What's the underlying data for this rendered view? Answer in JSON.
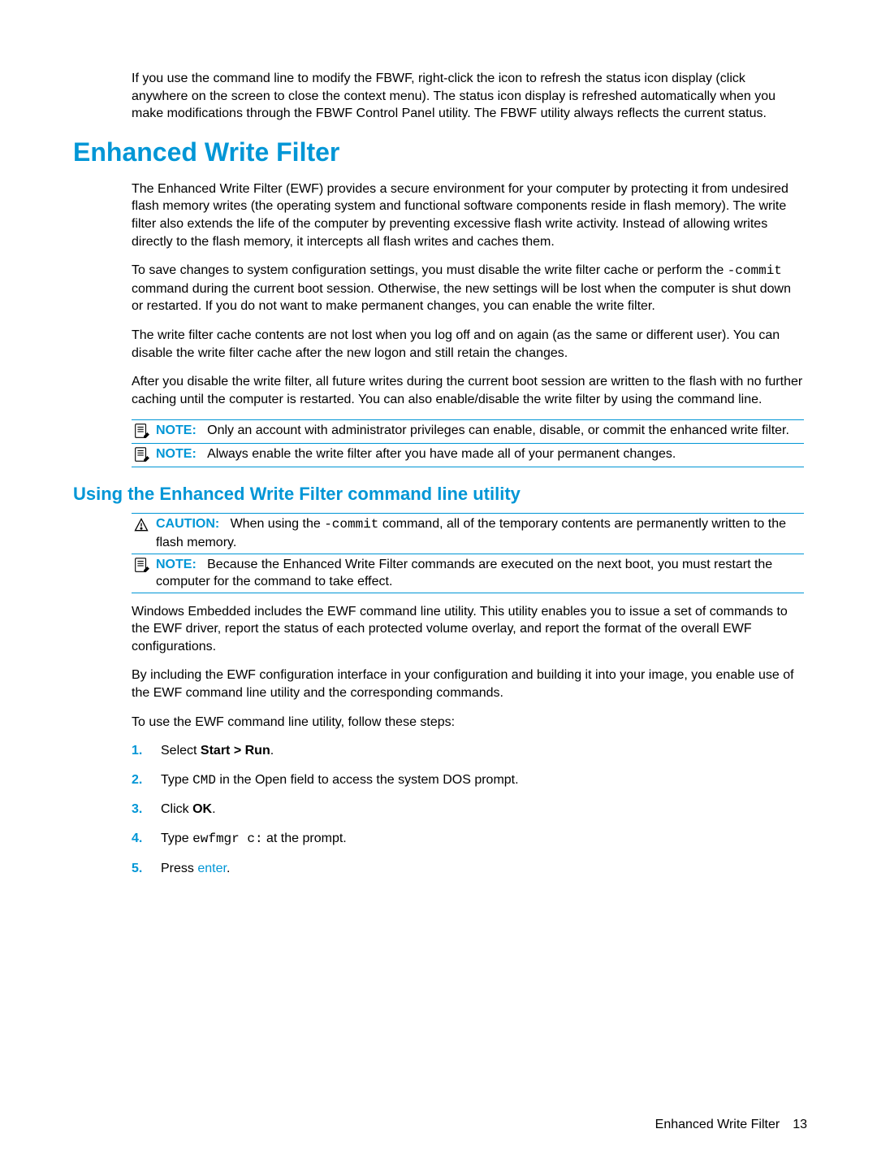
{
  "intro": "If you use the command line to modify the FBWF, right-click the icon to refresh the status icon display (click anywhere on the screen to close the context menu). The status icon display is refreshed automatically when you make modifications through the FBWF Control Panel utility. The FBWF utility always reflects the current status.",
  "h1": "Enhanced Write Filter",
  "p1": "The Enhanced Write Filter (EWF) provides a secure environment for your computer by protecting it from undesired flash memory writes (the operating system and functional software components reside in flash memory). The write filter also extends the life of the computer by preventing excessive flash write activity. Instead of allowing writes directly to the flash memory, it intercepts all flash writes and caches them.",
  "p2a": "To save changes to system configuration settings, you must disable the write filter cache or perform the ",
  "p2b": " command during the current boot session. Otherwise, the new settings will be lost when the computer is shut down or restarted. If you do not want to make permanent changes, you can enable the write filter.",
  "code_commit": "-commit",
  "p3": "The write filter cache contents are not lost when you log off and on again (as the same or different user). You can disable the write filter cache after the new logon and still retain the changes.",
  "p4": "After you disable the write filter, all future writes during the current boot session are written to the flash with no further caching until the computer is restarted. You can also enable/disable the write filter by using the command line.",
  "note_label": "NOTE:",
  "caution_label": "CAUTION:",
  "note1": "Only an account with administrator privileges can enable, disable, or commit the enhanced write filter.",
  "note2": "Always enable the write filter after you have made all of your permanent changes.",
  "h2": "Using the Enhanced Write Filter command line utility",
  "caution_a": "When using the ",
  "caution_b": " command, all of the temporary contents are permanently written to the flash memory.",
  "note3": "Because the Enhanced Write Filter commands are executed on the next boot, you must restart the computer for the command to take effect.",
  "p5": "Windows Embedded includes the EWF command line utility. This utility enables you to issue a set of commands to the EWF driver, report the status of each protected volume overlay, and report the format of the overall EWF configurations.",
  "p6": "By including the EWF configuration interface in your configuration and building it into your image, you enable use of the EWF command line utility and the corresponding commands.",
  "p7": "To use the EWF command line utility, follow these steps:",
  "steps": {
    "n1": "1.",
    "s1a": "Select ",
    "s1b": "Start > Run",
    "s1c": ".",
    "n2": "2.",
    "s2a": "Type ",
    "s2b": "CMD",
    "s2c": " in the Open field to access the system DOS prompt.",
    "n3": "3.",
    "s3a": "Click ",
    "s3b": "OK",
    "s3c": ".",
    "n4": "4.",
    "s4a": "Type ",
    "s4b": "ewfmgr c:",
    "s4c": " at the prompt.",
    "n5": "5.",
    "s5a": "Press ",
    "s5b": "enter",
    "s5c": "."
  },
  "footer_title": "Enhanced Write Filter",
  "footer_page": "13"
}
